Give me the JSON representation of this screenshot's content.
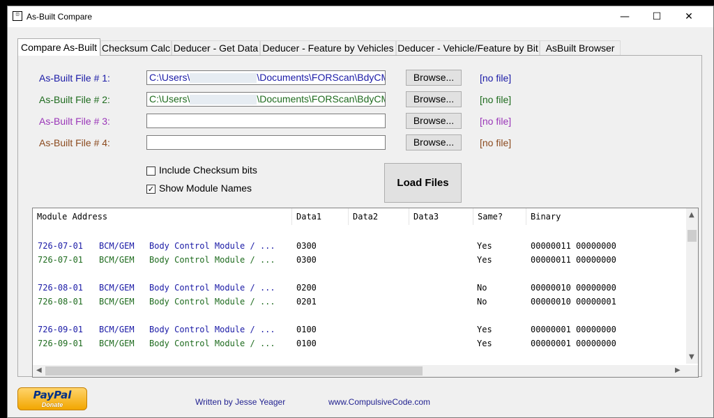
{
  "window": {
    "title": "As-Built Compare",
    "icon": "app-icon",
    "min": "—",
    "max": "☐",
    "close": "✕"
  },
  "tabs": [
    {
      "label": "Compare As-Built"
    },
    {
      "label": "Checksum Calc"
    },
    {
      "label": "Deducer - Get Data"
    },
    {
      "label": "Deducer - Feature by Vehicles"
    },
    {
      "label": "Deducer - Vehicle/Feature by Bit"
    },
    {
      "label": "AsBuilt Browser"
    }
  ],
  "files": [
    {
      "label": "As-Built File # 1:",
      "path_start": "C:\\Users\\",
      "path_end": "\\Documents\\FORScan\\BdyCM-",
      "browse": "Browse...",
      "status": "[no file]",
      "color": "#1a1aa6"
    },
    {
      "label": "As-Built File # 2:",
      "path_start": "C:\\Users\\",
      "path_end": "\\Documents\\FORScan\\BdyCM-",
      "browse": "Browse...",
      "status": "[no file]",
      "color": "#1e6b1e"
    },
    {
      "label": "As-Built File # 3:",
      "path_start": "",
      "path_end": "",
      "browse": "Browse...",
      "status": "[no file]",
      "color": "#9a36b8"
    },
    {
      "label": "As-Built File # 4:",
      "path_start": "",
      "path_end": "",
      "browse": "Browse...",
      "status": "[no file]",
      "color": "#8b4a1e"
    }
  ],
  "options": {
    "include_checksum": {
      "label": "Include Checksum bits",
      "checked": false
    },
    "show_module_names": {
      "label": "Show Module Names",
      "checked": true,
      "mark": "✓"
    }
  },
  "load_button": "Load Files",
  "table": {
    "headers": [
      "Module Address",
      "Data1",
      "Data2",
      "Data3",
      "Same?",
      "Binary"
    ],
    "rows": [
      {
        "addr": "726-07-01",
        "module": "BCM/GEM",
        "desc": "Body Control Module / ...",
        "data1": "0300",
        "same": "Yes",
        "binary": "00000011 00000000",
        "color": "#1a1aa6"
      },
      {
        "addr": "726-07-01",
        "module": "BCM/GEM",
        "desc": "Body Control Module / ...",
        "data1": "0300",
        "same": "Yes",
        "binary": "00000011 00000000",
        "color": "#1e6b1e"
      },
      {
        "addr": "726-08-01",
        "module": "BCM/GEM",
        "desc": "Body Control Module / ...",
        "data1": "0200",
        "same": "No",
        "binary": "00000010 00000000",
        "color": "#1a1aa6"
      },
      {
        "addr": "726-08-01",
        "module": "BCM/GEM",
        "desc": "Body Control Module / ...",
        "data1": "0201",
        "same": "No",
        "binary": "00000010 00000001",
        "color": "#1e6b1e"
      },
      {
        "addr": "726-09-01",
        "module": "BCM/GEM",
        "desc": "Body Control Module / ...",
        "data1": "0100",
        "same": "Yes",
        "binary": "00000001 00000000",
        "color": "#1a1aa6"
      },
      {
        "addr": "726-09-01",
        "module": "BCM/GEM",
        "desc": "Body Control Module / ...",
        "data1": "0100",
        "same": "Yes",
        "binary": "00000001 00000000",
        "color": "#1e6b1e"
      }
    ]
  },
  "footer": {
    "paypal_brand": "PayPal",
    "paypal_action": "Donate",
    "author": "Written by Jesse Yeager",
    "website": "www.CompulsiveCode.com"
  }
}
